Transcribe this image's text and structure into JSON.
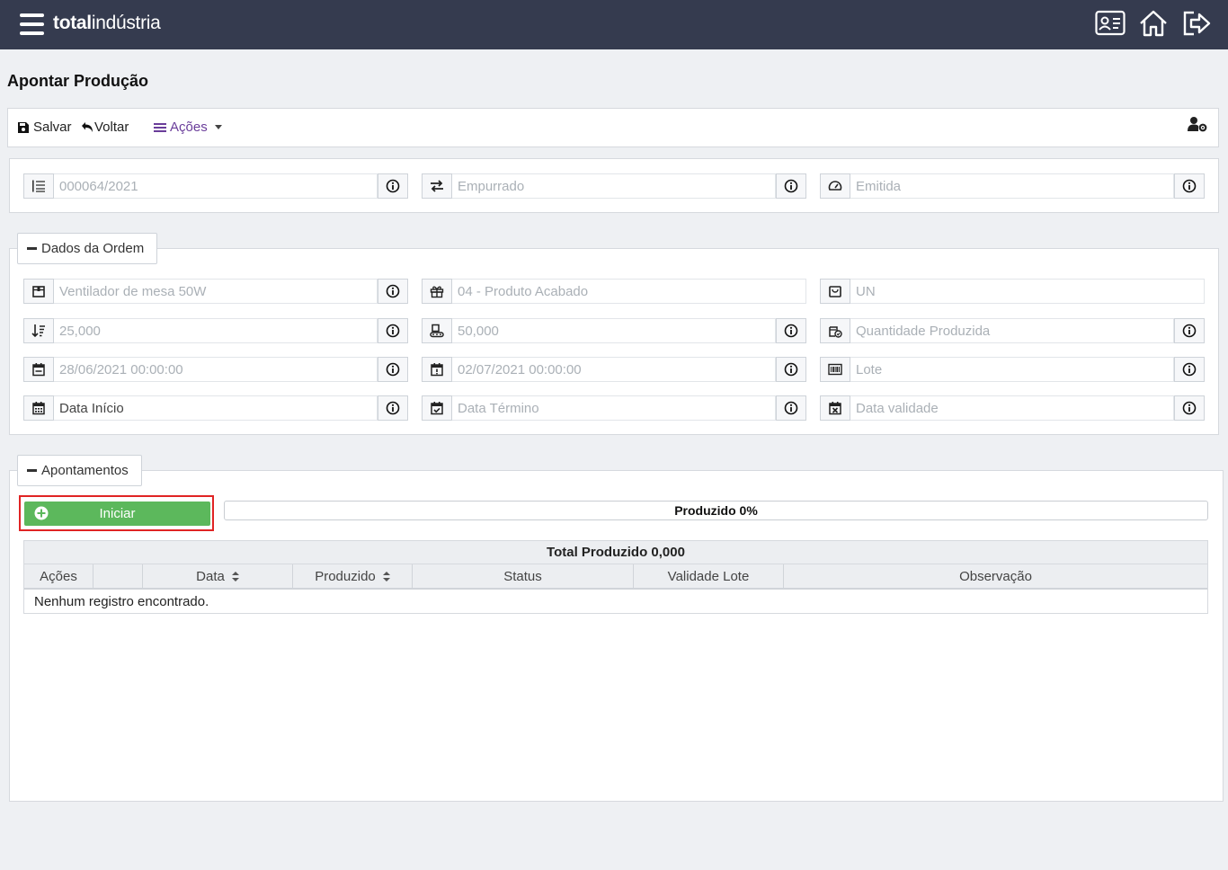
{
  "header": {
    "brand_bold": "total",
    "brand_light": "indústria",
    "icons": [
      "menu-icon",
      "id-card-icon",
      "home-icon",
      "logout-icon"
    ]
  },
  "page": {
    "title": "Apontar Produção"
  },
  "toolbar": {
    "save_label": "Salvar",
    "back_label": "Voltar",
    "actions_label": "Ações",
    "accent": "#6a3d9a"
  },
  "summary": {
    "order_number": "000064/2021",
    "type": "Empurrado",
    "status": "Emitida"
  },
  "order_section": {
    "legend": "Dados da Ordem",
    "product_placeholder": "Ventilador de mesa 50W",
    "product_type_placeholder": "04 - Produto Acabado",
    "unit_placeholder": "UN",
    "qty_planned": "25,000",
    "qty_capacity": "50,000",
    "qty_produced_placeholder": "Quantidade Produzida",
    "planned_start": "28/06/2021 00:00:00",
    "planned_end": "02/07/2021 00:00:00",
    "lot_placeholder": "Lote",
    "start_date_placeholder": "Data Início",
    "end_date_placeholder": "Data Término",
    "expiry_placeholder": "Data validade"
  },
  "appointments": {
    "legend": "Apontamentos",
    "start_button": "Iniciar",
    "progress_label": "Produzido 0%",
    "progress_value": 0,
    "button_color": "#5cb85c",
    "highlight_color": "#e02424",
    "table": {
      "caption": "Total Produzido 0,000",
      "columns": [
        "Ações",
        "",
        "Data",
        "Produzido",
        "Status",
        "Validade Lote",
        "Observação"
      ],
      "empty_message": "Nenhum registro encontrado."
    }
  }
}
